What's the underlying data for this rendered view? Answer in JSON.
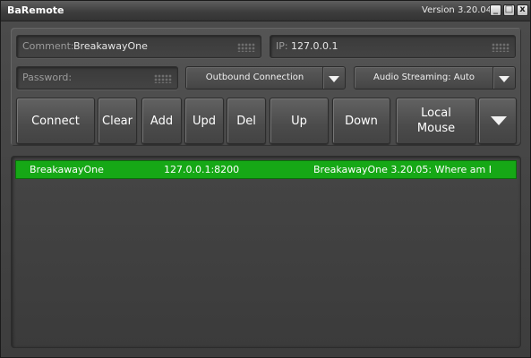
{
  "window": {
    "title": "BaRemote",
    "version": "Version 3.20.04",
    "controls": {
      "minimize": "_",
      "maximize": "□",
      "close": "x"
    }
  },
  "fields": {
    "comment": {
      "label": "Comment:",
      "value": "BreakawayOne"
    },
    "ip": {
      "label": "IP:",
      "value": "127.0.0.1"
    },
    "password": {
      "label": "Password:",
      "value": ""
    }
  },
  "dropdowns": {
    "connection": {
      "selected": "Outbound Connection"
    },
    "audio": {
      "selected": "Audio Streaming: Auto"
    }
  },
  "buttons": {
    "connect": "Connect",
    "clear": "Clear",
    "add": "Add",
    "upd": "Upd",
    "del": "Del",
    "up": "Up",
    "down": "Down",
    "local_mouse_line1": "Local",
    "local_mouse_line2": "Mouse"
  },
  "icons": {
    "minimize": "minimize-icon",
    "maximize": "maximize-icon",
    "close": "close-icon",
    "dropdown": "chevron-down-icon",
    "grip": "grip-dots-icon"
  },
  "connections": [
    {
      "name": "BreakawayOne",
      "address": "127.0.0.1:8200",
      "info": "BreakawayOne 3.20.05: Where am I"
    }
  ],
  "colors": {
    "selected_row": "#16a816",
    "background": "#4a4a4a"
  }
}
